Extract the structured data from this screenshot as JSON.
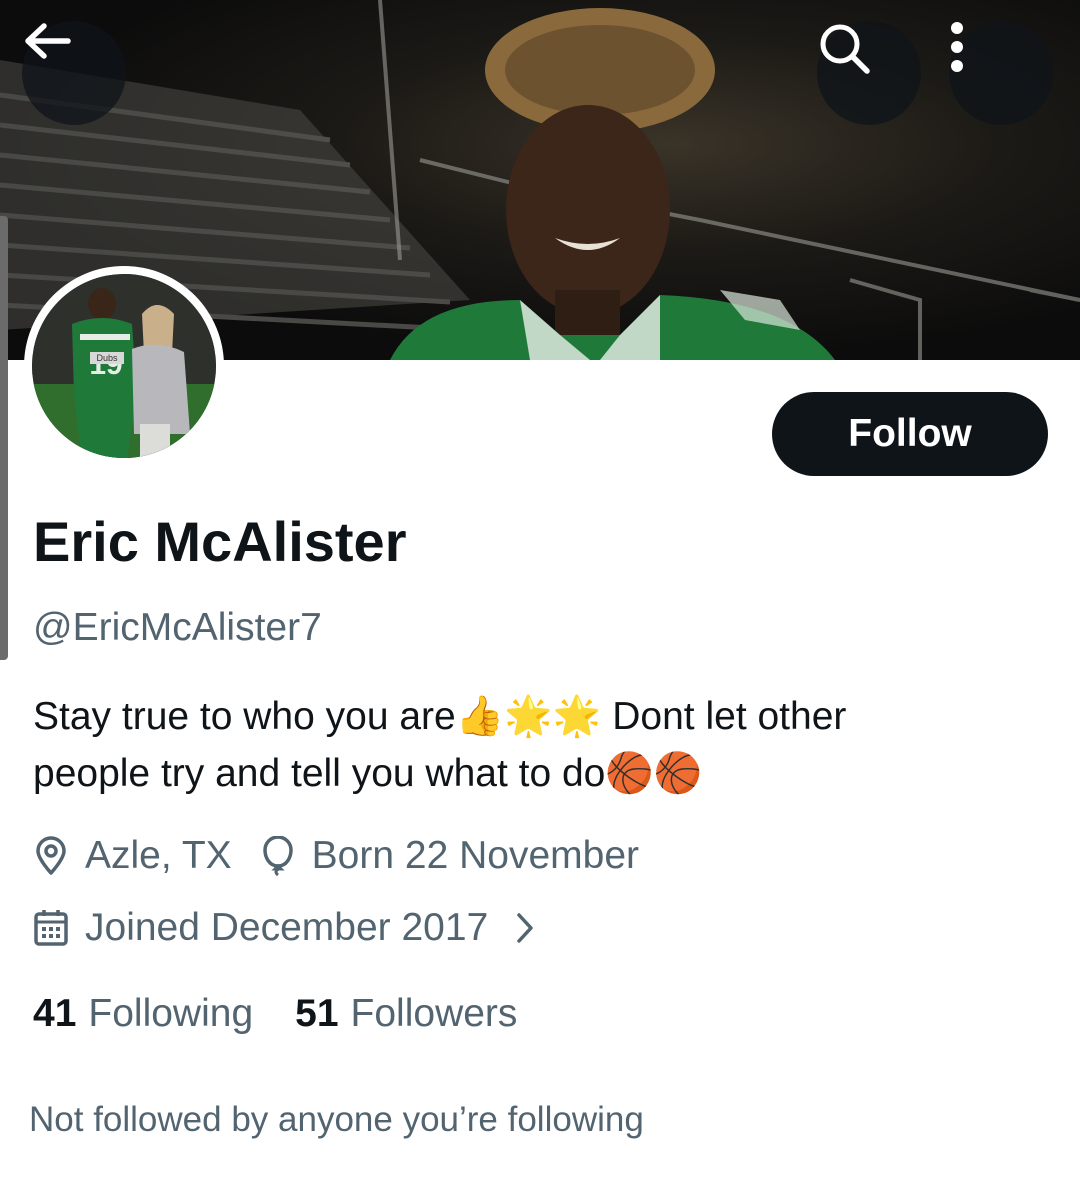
{
  "profile": {
    "display_name": "Eric McAlister",
    "handle": "@EricMcAlister7",
    "bio_line1": "Stay true to who you are👍🌟🌟 Dont let other",
    "bio_line2": "people try and tell you what to do🏀🏀",
    "location": "Azle, TX",
    "birthday": "Born 22 November",
    "joined": "Joined December 2017",
    "following_count": "41",
    "following_label": "Following",
    "followers_count": "51",
    "followers_label": "Followers",
    "mutuals_note": "Not followed by anyone you’re following"
  },
  "actions": {
    "follow_label": "Follow"
  },
  "icons": {
    "back": "arrow-left-icon",
    "search": "search-icon",
    "more": "more-vertical-icon",
    "location": "location-pin-icon",
    "birthday": "balloon-icon",
    "joined": "calendar-icon",
    "joined_chevron": "chevron-right-icon"
  },
  "avatar_jersey_text": "Dubs",
  "colors": {
    "text_primary": "#0f1419",
    "text_secondary": "#536471",
    "follow_bg": "#0f1419",
    "jersey_green": "#1f7a3a"
  }
}
